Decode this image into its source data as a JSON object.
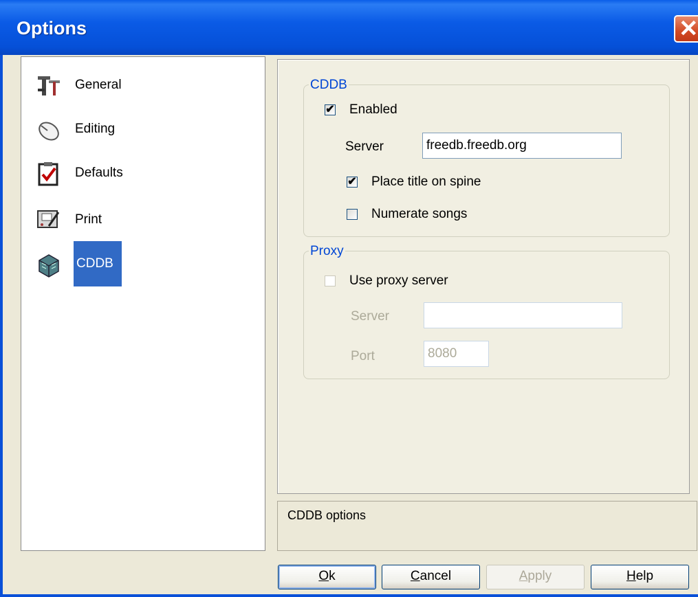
{
  "window": {
    "title": "Options",
    "close_glyph": "✕"
  },
  "nav": {
    "items": [
      {
        "label": "General",
        "icon": "tools-icon"
      },
      {
        "label": "Editing",
        "icon": "mouse-icon"
      },
      {
        "label": "Defaults",
        "icon": "checklist-icon"
      },
      {
        "label": "Print",
        "icon": "print-icon"
      },
      {
        "label": "CDDB",
        "icon": "disc-icon",
        "selected": true
      }
    ]
  },
  "cddb": {
    "group_title": "CDDB",
    "enabled": {
      "label": "Enabled",
      "checked": true,
      "mark": "✔"
    },
    "server_label": "Server",
    "server_value": "freedb.freedb.org",
    "place_title": {
      "label": "Place title on spine",
      "checked": true,
      "mark": "✔"
    },
    "numerate": {
      "label": "Numerate songs",
      "checked": false
    }
  },
  "proxy": {
    "group_title": "Proxy",
    "use_proxy": {
      "label": "Use proxy server",
      "checked": false
    },
    "server_label": "Server",
    "server_value": "",
    "port_label": "Port",
    "port_value": "8080"
  },
  "description": "CDDB options",
  "buttons": {
    "ok": {
      "mnemonic": "O",
      "rest": "k"
    },
    "cancel": {
      "mnemonic": "C",
      "rest": "ancel"
    },
    "apply": {
      "mnemonic": "A",
      "rest": "pply"
    },
    "help": {
      "mnemonic": "H",
      "rest": "elp"
    }
  },
  "colors": {
    "title_bar": "#0b5be6",
    "selection": "#316ac5",
    "group_title": "#0046d5",
    "disabled_text": "#acaa99"
  }
}
